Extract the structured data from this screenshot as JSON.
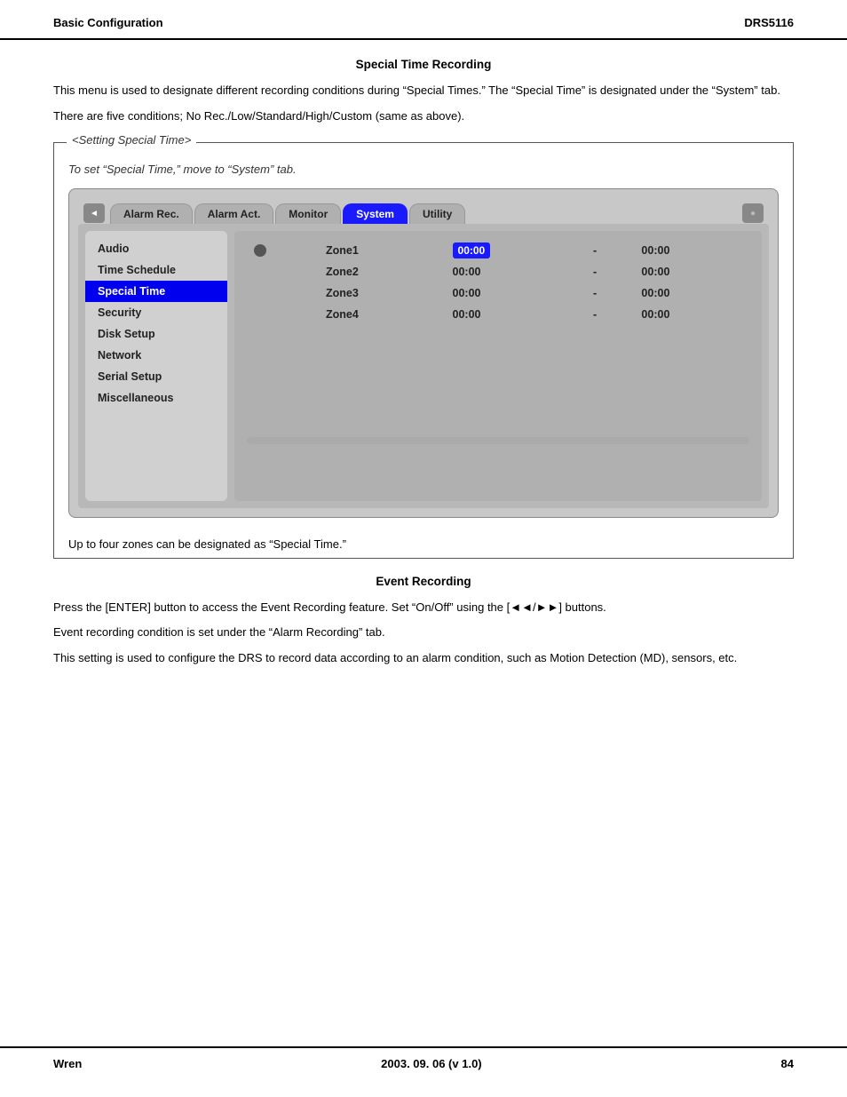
{
  "header": {
    "left": "Basic Configuration",
    "right": "DRS5116"
  },
  "special_time_recording": {
    "title": "Special Time Recording",
    "para1": "This menu is used to designate different recording conditions during “Special Times.”   The “Special Time” is designated under the “System” tab.",
    "para2": "There are five conditions; No Rec./Low/Standard/High/Custom (same as above).",
    "setting_box_title": "<Setting Special Time>",
    "setting_note": "To set “Special Time,” move to “System” tab.",
    "tabs": [
      {
        "label": "Alarm Rec.",
        "active": false
      },
      {
        "label": "Alarm Act.",
        "active": false
      },
      {
        "label": "Monitor",
        "active": false
      },
      {
        "label": "System",
        "active": true
      },
      {
        "label": "Utility",
        "active": false
      }
    ],
    "menu_items": [
      {
        "label": "Audio",
        "selected": false
      },
      {
        "label": "Time Schedule",
        "selected": false
      },
      {
        "label": "Special Time",
        "selected": true
      },
      {
        "label": "Security",
        "selected": false
      },
      {
        "label": "Disk Setup",
        "selected": false
      },
      {
        "label": "Network",
        "selected": false
      },
      {
        "label": "Serial Setup",
        "selected": false
      },
      {
        "label": "Miscellaneous",
        "selected": false
      }
    ],
    "zones": [
      {
        "name": "Zone1",
        "start": "00:00",
        "dash": "-",
        "end": "00:00"
      },
      {
        "name": "Zone2",
        "start": "00:00",
        "dash": "-",
        "end": "00:00"
      },
      {
        "name": "Zone3",
        "start": "00:00",
        "dash": "-",
        "end": "00:00"
      },
      {
        "name": "Zone4",
        "start": "00:00",
        "dash": "-",
        "end": "00:00"
      }
    ],
    "footer_note": "Up to four zones can be designated as “Special Time.”"
  },
  "event_recording": {
    "title": "Event Recording",
    "para1": "Press the [ENTER] button to access the Event Recording feature.   Set “On/Off” using the [◄◄/►►] buttons.",
    "para2": "Event recording condition is set under the “Alarm Recording” tab.",
    "para3": "This setting is used to configure the DRS to record data according to an alarm condition, such as Motion Detection (MD), sensors, etc."
  },
  "footer": {
    "left": "Wren",
    "center": "2003. 09. 06 (v 1.0)",
    "right": "84"
  }
}
